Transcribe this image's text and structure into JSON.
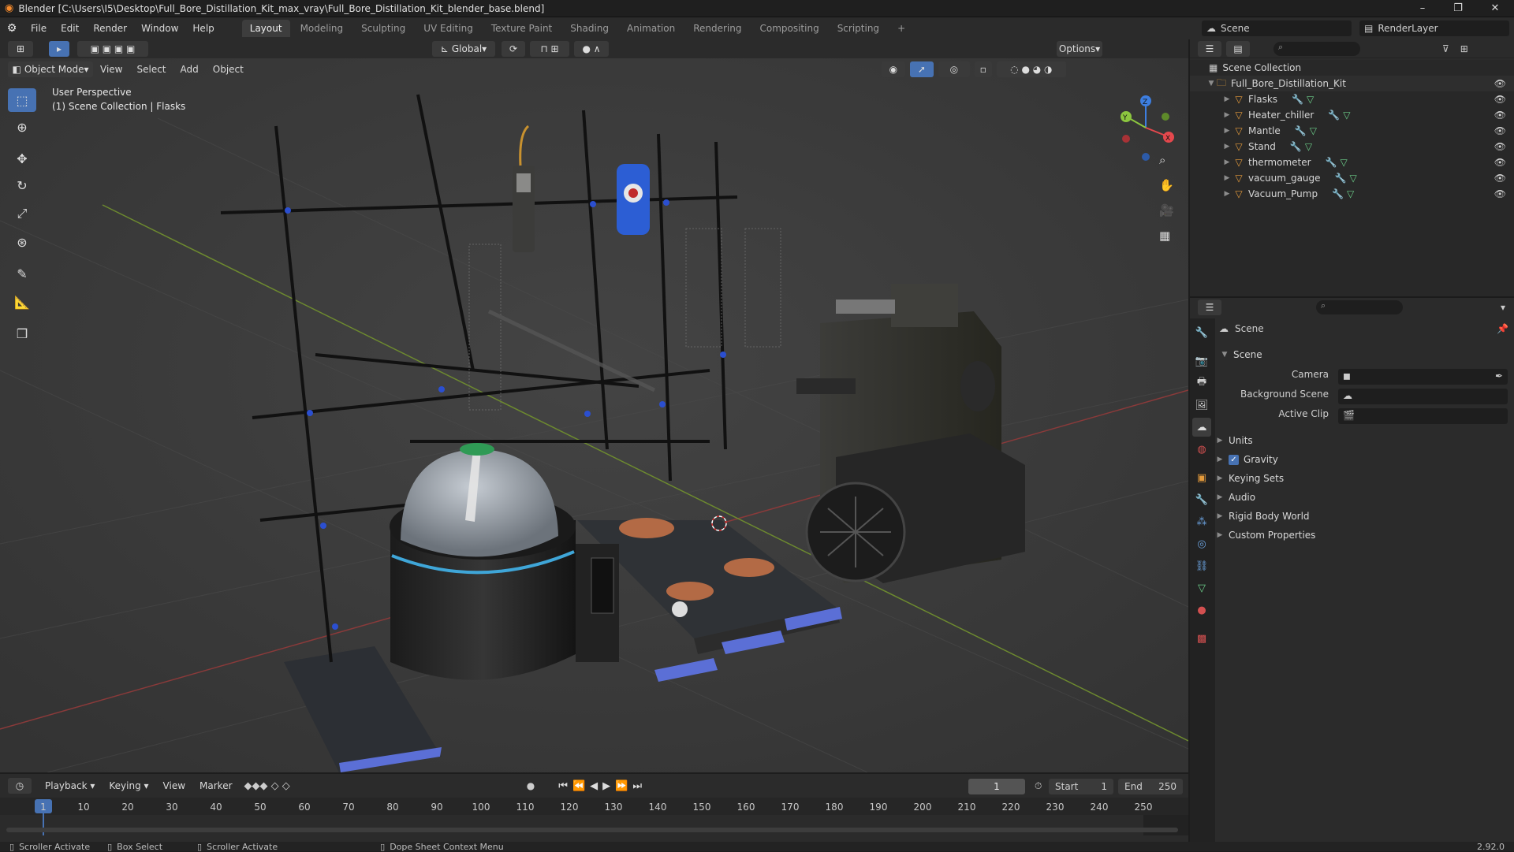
{
  "window": {
    "title": "Blender [C:\\Users\\I5\\Desktop\\Full_Bore_Distillation_Kit_max_vray\\Full_Bore_Distillation_Kit_blender_base.blend]",
    "controls": [
      "–",
      "❐",
      "✕"
    ]
  },
  "menu": {
    "items": [
      "File",
      "Edit",
      "Render",
      "Window",
      "Help"
    ],
    "workspaces": [
      "Layout",
      "Modeling",
      "Sculpting",
      "UV Editing",
      "Texture Paint",
      "Shading",
      "Animation",
      "Rendering",
      "Compositing",
      "Scripting"
    ],
    "active_workspace": "Layout",
    "add_tab": "+",
    "scene_name": "Scene",
    "render_layer": "RenderLayer"
  },
  "viewport": {
    "transform_orientation": "Global",
    "options_label": "Options",
    "mode": "Object Mode",
    "menus": [
      "View",
      "Select",
      "Add",
      "Object"
    ],
    "perspective_label": "User Perspective",
    "collection_label": "(1) Scene Collection | Flasks",
    "gizmo_axes": [
      "X",
      "Y",
      "Z"
    ],
    "tools": [
      "select-box-icon",
      "cursor-icon",
      "move-icon",
      "rotate-icon",
      "scale-icon",
      "transform-icon",
      "annotate-icon",
      "measure-icon",
      "add-cube-icon"
    ]
  },
  "outliner": {
    "root": "Scene Collection",
    "collection": "Full_Bore_Distillation_Kit",
    "objects": [
      "Flasks",
      "Heater_chiller",
      "Mantle",
      "Stand",
      "thermometer",
      "vacuum_gauge",
      "Vacuum_Pump"
    ]
  },
  "properties": {
    "context": "Scene",
    "section_title": "Scene",
    "fields": [
      {
        "label": "Camera"
      },
      {
        "label": "Background Scene"
      },
      {
        "label": "Active Clip"
      }
    ],
    "collapsed_sections": [
      "Units",
      "Gravity",
      "Keying Sets",
      "Audio",
      "Rigid Body World",
      "Custom Properties"
    ],
    "gravity_checked": true
  },
  "timeline": {
    "menus": [
      "Playback",
      "Keying",
      "View",
      "Marker"
    ],
    "current_frame": "1",
    "start_label": "Start",
    "start": "1",
    "end_label": "End",
    "end": "250",
    "ticks": [
      "1",
      "10",
      "20",
      "30",
      "40",
      "50",
      "60",
      "70",
      "80",
      "90",
      "100",
      "110",
      "120",
      "130",
      "140",
      "150",
      "160",
      "170",
      "180",
      "190",
      "200",
      "210",
      "220",
      "230",
      "240",
      "250"
    ]
  },
  "status": {
    "items": [
      "Scroller Activate",
      "Box Select",
      "Scroller Activate",
      "Dope Sheet Context Menu"
    ],
    "version": "2.92.0"
  },
  "colors": {
    "accent": "#4772b3",
    "object_orange": "#e49a3b",
    "modifier_blue": "#6aa0dc",
    "mesh_green": "#6ccf8a"
  }
}
